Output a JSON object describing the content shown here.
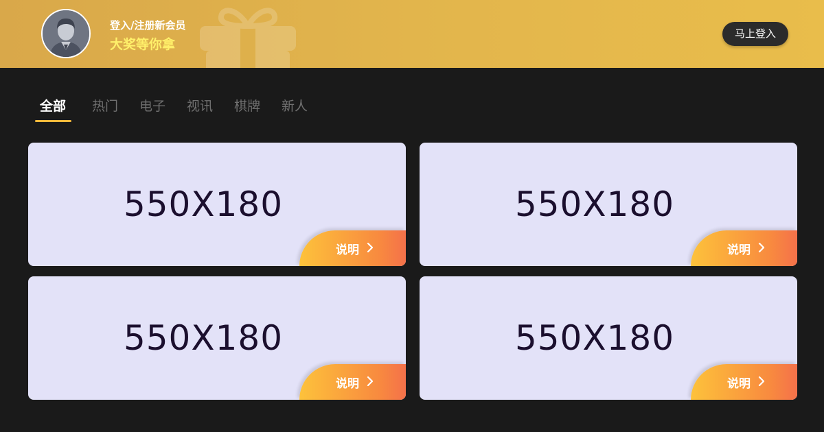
{
  "header": {
    "line1": "登入/注册新会员",
    "line2": "大奖等你拿",
    "login_button": "马上登入"
  },
  "tabs": [
    {
      "label": "全部",
      "active": true
    },
    {
      "label": "热门",
      "active": false
    },
    {
      "label": "电子",
      "active": false
    },
    {
      "label": "视讯",
      "active": false
    },
    {
      "label": "棋牌",
      "active": false
    },
    {
      "label": "新人",
      "active": false
    }
  ],
  "cards": [
    {
      "placeholder": "550X180",
      "button": "说明"
    },
    {
      "placeholder": "550X180",
      "button": "说明"
    },
    {
      "placeholder": "550X180",
      "button": "说明"
    },
    {
      "placeholder": "550X180",
      "button": "说明"
    }
  ],
  "colors": {
    "header_gold": "#e2b54c",
    "accent_yellow": "#f6b83b",
    "highlight_text": "#fff06a",
    "background": "#1a1a1a",
    "card_bg": "#e3e2f8",
    "button_orange": "#f88a3f"
  },
  "icons": [
    "avatar-icon",
    "gift-icon",
    "chevron-right-icon"
  ]
}
